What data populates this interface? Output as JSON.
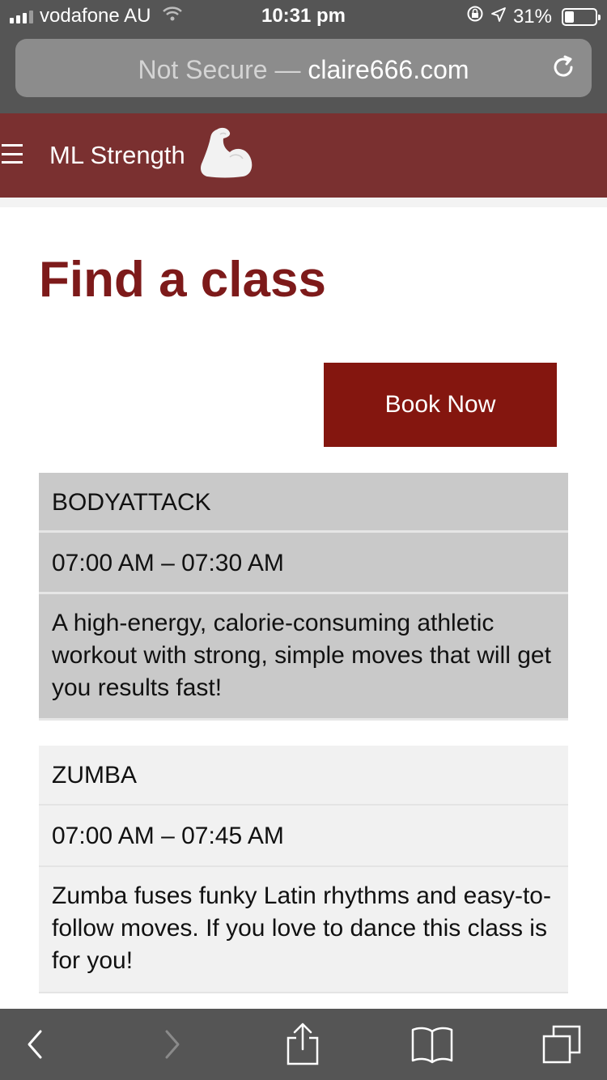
{
  "status_bar": {
    "carrier": "vodafone AU",
    "time": "10:31 pm",
    "battery": "31%",
    "battery_level": 0.31,
    "icons": [
      "signal-icon",
      "wifi-icon",
      "orientation-lock-icon",
      "location-icon",
      "battery-icon"
    ]
  },
  "browser": {
    "url_prefix": "Not Secure —",
    "url_host": "claire666.com",
    "icons": [
      "reload-icon",
      "back-icon",
      "forward-icon",
      "share-icon",
      "bookmarks-icon",
      "tabs-icon"
    ]
  },
  "site": {
    "brand": "ML Strength",
    "icons": [
      "menu-icon",
      "flexed-bicep-icon"
    ],
    "header_color": "#7a3030"
  },
  "page": {
    "title": "Find a class",
    "book_button": "Book Now",
    "accent_color": "#7d1a1a"
  },
  "classes": [
    {
      "name": "BODYATTACK",
      "time": "07:00 AM – 07:30 AM",
      "description": "A high-energy, calorie-consuming athletic workout with strong, simple moves that will get you results fast!"
    },
    {
      "name": "ZUMBA",
      "time": "07:00 AM – 07:45 AM",
      "description": "Zumba fuses funky Latin rhythms and easy-to-follow moves. If you love to dance this class is for you!"
    }
  ]
}
